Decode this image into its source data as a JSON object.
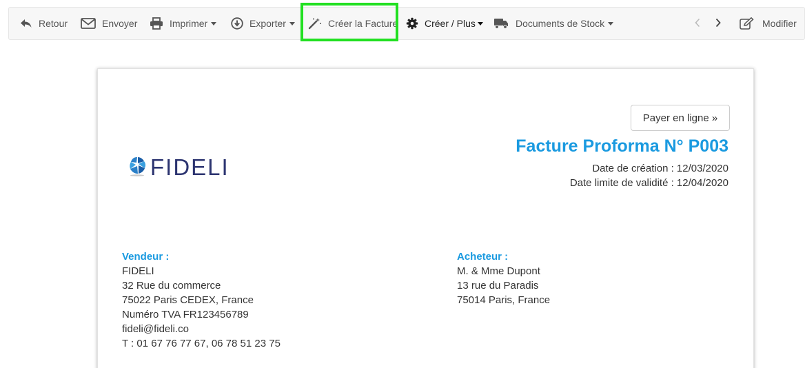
{
  "toolbar": {
    "back_label": "Retour",
    "send_label": "Envoyer",
    "print_label": "Imprimer",
    "export_label": "Exporter",
    "create_invoice_label": "Créer la Facture",
    "create_more_label": "Créer / Plus",
    "stock_docs_label": "Documents de Stock",
    "edit_label": "Modifier",
    "highlight_color": "#22e022"
  },
  "document": {
    "pay_online_label": "Payer en ligne »",
    "logo_text": "FIDELI",
    "title": "Facture Proforma N° P003",
    "creation_date": "Date de création : 12/03/2020",
    "validity_date": "Date limite de validité : 12/04/2020",
    "accent_color": "#1a9ae0"
  },
  "seller": {
    "heading": "Vendeur :",
    "name": "FIDELI",
    "street": "32 Rue du commerce",
    "city": "75022 Paris CEDEX, France",
    "vat": "Numéro TVA FR123456789",
    "email": "fideli@fideli.co",
    "phone": "T : 01 67 76 77 67, 06 78 51 23 75"
  },
  "buyer": {
    "heading": "Acheteur :",
    "name": "M. & Mme Dupont",
    "street": "13 rue du Paradis",
    "city": "75014 Paris, France"
  }
}
